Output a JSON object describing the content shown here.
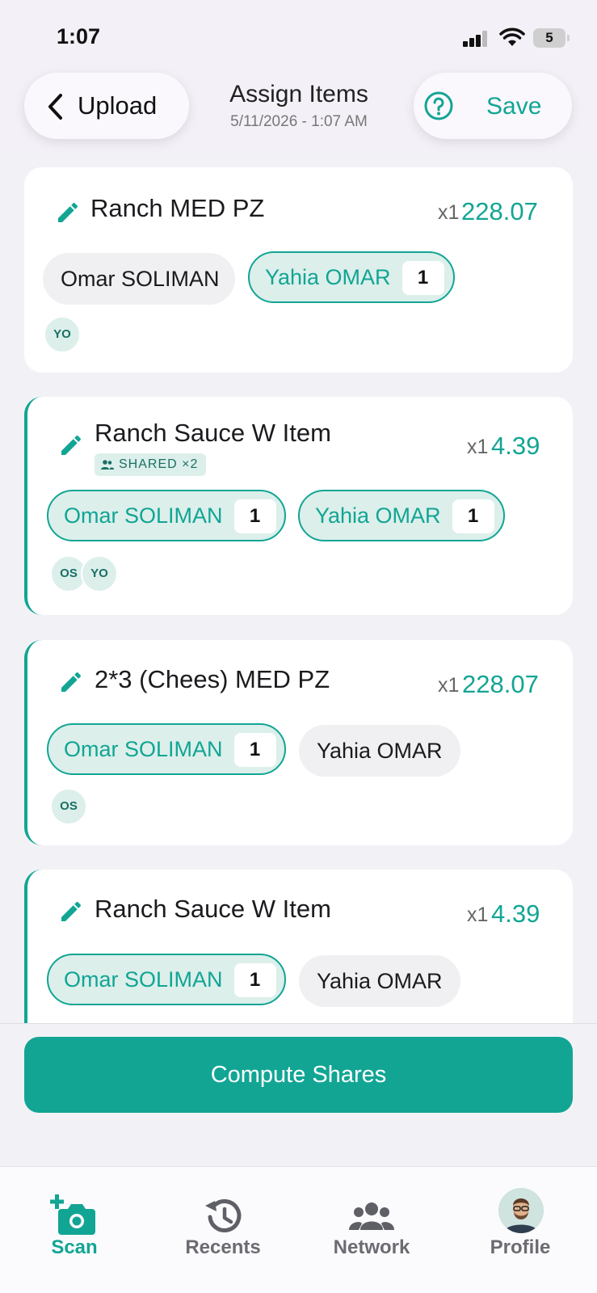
{
  "status_bar": {
    "time": "1:07",
    "battery": "5",
    "signal_icon": "signal-icon",
    "wifi_icon": "wifi-icon"
  },
  "header": {
    "back_label": "Upload",
    "title": "Assign Items",
    "subtitle": "5/11/2026 - 1:07 AM",
    "save_label": "Save"
  },
  "items": [
    {
      "name": "Ranch MED PZ",
      "qty": "x1",
      "price": "228.07",
      "people": [
        {
          "name": "Omar SOLIMAN",
          "selected": false
        },
        {
          "name": "Yahia OMAR",
          "selected": true,
          "count": "1"
        }
      ],
      "avatars": [
        "YO"
      ]
    },
    {
      "name": "Ranch Sauce W Item",
      "qty": "x1",
      "price": "4.39",
      "shared_label": "SHARED ×2",
      "people": [
        {
          "name": "Omar SOLIMAN",
          "selected": true,
          "count": "1"
        },
        {
          "name": "Yahia OMAR",
          "selected": true,
          "count": "1"
        }
      ],
      "avatars": [
        "OS",
        "YO"
      ]
    },
    {
      "name": "2*3 (Chees) MED PZ",
      "qty": "x1",
      "price": "228.07",
      "people": [
        {
          "name": "Omar SOLIMAN",
          "selected": true,
          "count": "1"
        },
        {
          "name": "Yahia OMAR",
          "selected": false
        }
      ],
      "avatars": [
        "OS"
      ]
    },
    {
      "name": "Ranch Sauce W Item",
      "qty": "x1",
      "price": "4.39",
      "people": [
        {
          "name": "Omar SOLIMAN",
          "selected": true,
          "count": "1"
        },
        {
          "name": "Yahia OMAR",
          "selected": false
        }
      ],
      "avatars": []
    }
  ],
  "compute_label": "Compute Shares",
  "tabs": [
    {
      "label": "Scan",
      "icon": "camera-plus-icon",
      "active": true
    },
    {
      "label": "Recents",
      "icon": "history-icon",
      "active": false
    },
    {
      "label": "Network",
      "icon": "people-icon",
      "active": false
    },
    {
      "label": "Profile",
      "icon": "avatar-icon",
      "active": false
    }
  ],
  "colors": {
    "accent": "#12a594",
    "accent_light": "#dcefeb",
    "background": "#f2f2f6"
  }
}
